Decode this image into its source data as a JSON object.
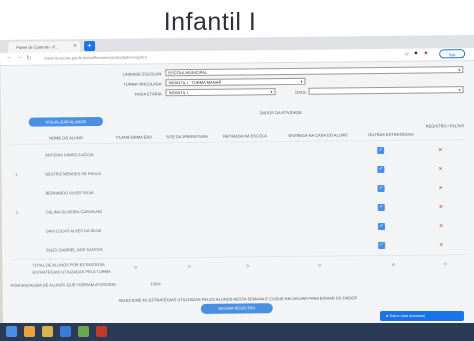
{
  "slide": {
    "title": "Infantil I"
  },
  "browser": {
    "tab_label": "Painel de Controle - P...",
    "url": "sistema.escola.gov.br/portal/frequencia/atividades/registro"
  },
  "filters": {
    "unidade_label": "UNIDADE ESCOLAR:",
    "unidade_value": "ESCOLA MUNICIPAL",
    "turma_label": "TURMA VINCULADA:",
    "turma_value": "INFANTIL I - TURMA MANHÃ",
    "faixa_label": "FAIXA ETÁRIA:",
    "faixa_value": "INFANTIL I",
    "data_label": "DATA:",
    "data_value": ""
  },
  "content": {
    "view_button": "VISUALIZAR ALUNOS",
    "section_title": "DADOS DA ATIVIDADE"
  },
  "table": {
    "headers": [
      "NOME DO ALUNO",
      "PLATAFORMA EAD",
      "SITE DA PREFEITURA",
      "RETIRADA NA ESCOLA",
      "ENTREGA NA CASA DO ALUNO",
      "OUTRAS ESTRATÉGIAS",
      "REGISTRO / FALTAS"
    ],
    "rows": [
      {
        "num": "",
        "name": "ANTONIA DANIELA ACCIA"
      },
      {
        "num": "1",
        "name": "BEATRIZ MENDES DE PAULO"
      },
      {
        "num": "",
        "name": "BERNARDO ALVES SILVA"
      },
      {
        "num": "2",
        "name": "CELINA OLIVEIRA CARVALHO"
      },
      {
        "num": "",
        "name": "DAVI LUCAS ALVES DA SILVA"
      },
      {
        "num": "",
        "name": "ENZO GABRIEL DOS SANTOS"
      }
    ],
    "summary_1": "TOTAL DE ALUNOS POR ESTRATÉGIA",
    "summary_2": "ESTRATÉGIAS UTILIZADAS PELA TURMA",
    "summary_values": [
      "0",
      "0",
      "0",
      "0",
      "6",
      "0"
    ],
    "total_label": "PORCENTAGEM DE ALUNOS QUE FIZERAM ATIVIDADE:",
    "total_value": "100%"
  },
  "footer": {
    "note": "SELECIONE AS ESTRATÉGIAS UTILIZADAS PELOS ALUNOS NESTA SEMANA E CLIQUE EM SALVAR PARA ENVIAR OS DADOS",
    "save_button": "SALVAR REGISTRO",
    "sair_button": "Sair",
    "notification": "Salvo com sucesso!"
  },
  "icons": [
    "windows-icon",
    "chrome-icon",
    "folder-icon",
    "edge-icon",
    "mail-icon",
    "media-icon"
  ]
}
